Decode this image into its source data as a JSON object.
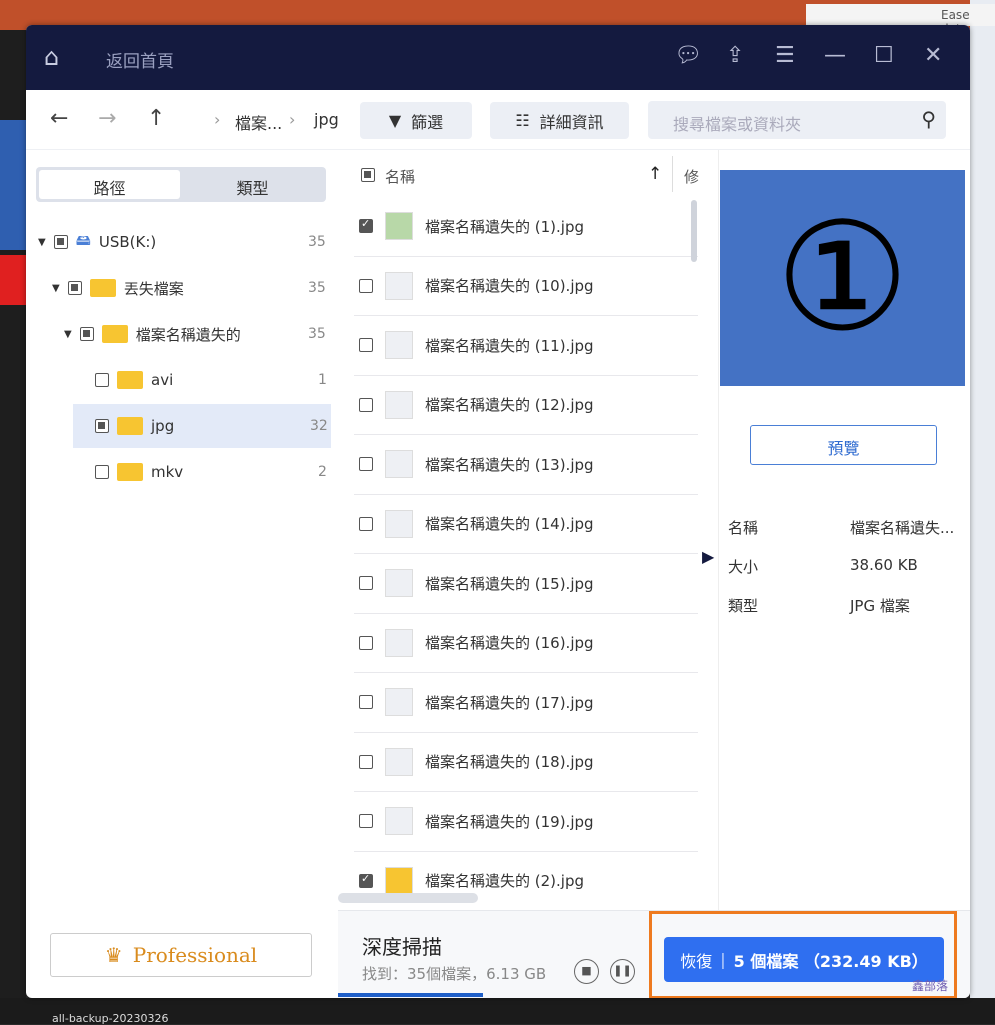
{
  "background": {
    "word_title": "Ease data",
    "taskbar_item": "all-backup-20230326"
  },
  "header": {
    "back_home": "返回首頁",
    "icons": [
      "home-icon",
      "feedback-icon",
      "upload-icon",
      "menu-icon",
      "minimize-icon",
      "maximize-icon",
      "close-icon"
    ]
  },
  "toolbar": {
    "breadcrumb": [
      "檔案...",
      "jpg"
    ],
    "filter": "篩選",
    "details": "詳細資訊",
    "search_placeholder": "搜尋檔案或資料夾"
  },
  "sidebar": {
    "tabs": [
      "路徑",
      "類型"
    ],
    "tree": [
      {
        "label": "USB(K:)",
        "count": "35"
      },
      {
        "label": "丟失檔案",
        "count": "35"
      },
      {
        "label": "檔案名稱遺失的",
        "count": "35"
      },
      {
        "label": "avi",
        "count": "1"
      },
      {
        "label": "jpg",
        "count": "32"
      },
      {
        "label": "mkv",
        "count": "2"
      }
    ],
    "professional": "Professional"
  },
  "list": {
    "col_name": "名稱",
    "col_modified": "修",
    "files": [
      {
        "name": "檔案名稱遺失的 (1).jpg",
        "checked": true
      },
      {
        "name": "檔案名稱遺失的 (10).jpg",
        "checked": false
      },
      {
        "name": "檔案名稱遺失的 (11).jpg",
        "checked": false
      },
      {
        "name": "檔案名稱遺失的 (12).jpg",
        "checked": false
      },
      {
        "name": "檔案名稱遺失的 (13).jpg",
        "checked": false
      },
      {
        "name": "檔案名稱遺失的 (14).jpg",
        "checked": false
      },
      {
        "name": "檔案名稱遺失的 (15).jpg",
        "checked": false
      },
      {
        "name": "檔案名稱遺失的 (16).jpg",
        "checked": false
      },
      {
        "name": "檔案名稱遺失的 (17).jpg",
        "checked": false
      },
      {
        "name": "檔案名稱遺失的 (18).jpg",
        "checked": false
      },
      {
        "name": "檔案名稱遺失的 (19).jpg",
        "checked": false
      },
      {
        "name": "檔案名稱遺失的 (2).jpg",
        "checked": true
      }
    ]
  },
  "detail": {
    "preview_glyph": "①",
    "preview_button": "預覽",
    "name_label": "名稱",
    "name_value": "檔案名稱遺失...",
    "size_label": "大小",
    "size_value": "38.60 KB",
    "type_label": "類型",
    "type_value": "JPG 檔案"
  },
  "footer": {
    "scan_title": "深度掃描",
    "scan_status": "找到：35個檔案，6.13 GB",
    "scan_progress_percent": 23,
    "recover_label": "恢復",
    "recover_summary": "5 個檔案 （232.49 KB）",
    "watermark": "鑫部落"
  },
  "colors": {
    "header": "#141a3f",
    "accent": "#2f6ff0",
    "highlight": "#ee7a1f"
  }
}
